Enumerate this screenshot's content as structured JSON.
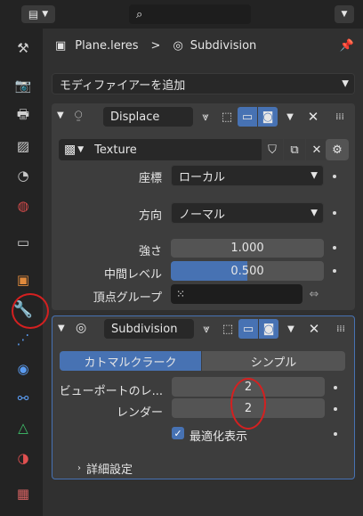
{
  "header": {
    "object_name": "Plane.leres",
    "breadcrumb_sep": ">",
    "modifier_name": "Subdivision"
  },
  "add_modifier": {
    "label": "モディファイアーを追加"
  },
  "displace": {
    "name": "Displace",
    "texture_label": "Texture",
    "coords_label": "座標",
    "coords_value": "ローカル",
    "direction_label": "方向",
    "direction_value": "ノーマル",
    "strength_label": "強さ",
    "strength_value": "1.000",
    "midlevel_label": "中間レベル",
    "midlevel_value": "0.500",
    "vgroup_label": "頂点グループ"
  },
  "subdivision": {
    "name": "Subdivision",
    "tab_catmull": "カトマルクラーク",
    "tab_simple": "シンプル",
    "viewport_label": "ビューポートのレ...",
    "viewport_value": "2",
    "render_label": "レンダー",
    "render_value": "2",
    "optimal_label": "最適化表示",
    "advanced_label": "詳細設定"
  },
  "icons": {
    "search": "search-icon",
    "pin": "pin-icon",
    "wrench": "wrench-icon"
  },
  "colors": {
    "accent": "#4772b3",
    "highlight_circle": "#d42020"
  }
}
